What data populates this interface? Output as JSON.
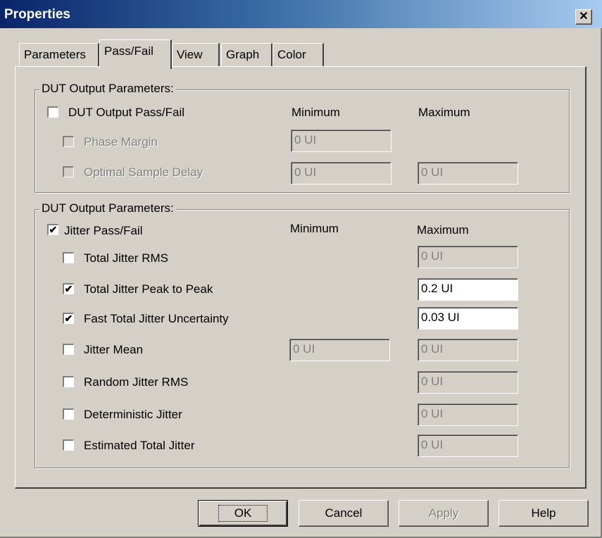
{
  "window": {
    "title": "Properties",
    "close_glyph": "✕"
  },
  "tabs": [
    {
      "label": "Parameters",
      "active": false
    },
    {
      "label": "Pass/Fail",
      "active": true
    },
    {
      "label": "View",
      "active": false
    },
    {
      "label": "Graph",
      "active": false
    },
    {
      "label": "Color",
      "active": false
    }
  ],
  "group1": {
    "title": "DUT Output Parameters:",
    "master": {
      "label": "DUT Output Pass/Fail",
      "checked": false
    },
    "col_min": "Minimum",
    "col_max": "Maximum",
    "rows": [
      {
        "label": "Phase Margin",
        "checked": false,
        "min": "0 UI"
      },
      {
        "label": "Optimal Sample Delay",
        "checked": false,
        "min": "0 UI",
        "max": "0 UI"
      }
    ]
  },
  "group2": {
    "title": "DUT Output Parameters:",
    "master": {
      "label": "Jitter Pass/Fail",
      "checked": true
    },
    "col_min": "Minimum",
    "col_max": "Maximum",
    "rows": [
      {
        "label": "Total Jitter RMS",
        "checked": false,
        "max": "0 UI"
      },
      {
        "label": "Total Jitter Peak to Peak",
        "checked": true,
        "max": "0.2 UI"
      },
      {
        "label": "Fast Total Jitter Uncertainty",
        "checked": true,
        "max": "0.03 UI"
      },
      {
        "label": "Jitter Mean",
        "checked": false,
        "min": "0 UI",
        "max": "0 UI"
      },
      {
        "label": "Random Jitter RMS",
        "checked": false,
        "max": "0 UI"
      },
      {
        "label": "Deterministic Jitter",
        "checked": false,
        "max": "0 UI"
      },
      {
        "label": "Estimated Total Jitter",
        "checked": false,
        "max": "0 UI"
      }
    ]
  },
  "check_glyph": "✔",
  "buttons": {
    "ok": "OK",
    "cancel": "Cancel",
    "apply": "Apply",
    "help": "Help"
  }
}
